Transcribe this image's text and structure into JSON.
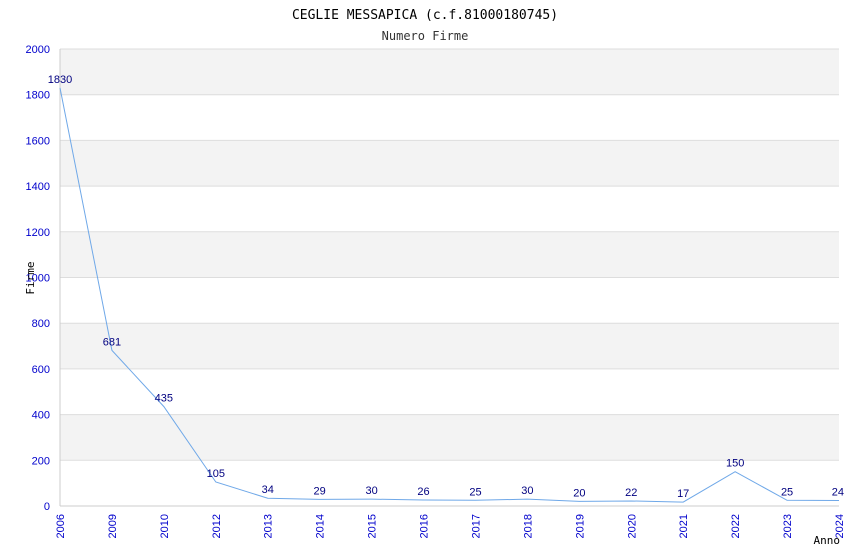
{
  "chart_data": {
    "type": "line",
    "title": "CEGLIE MESSAPICA (c.f.81000180745)",
    "subtitle": "Numero Firme",
    "xlabel": "Anno",
    "ylabel": "Firme",
    "categories": [
      "2006",
      "2009",
      "2010",
      "2012",
      "2013",
      "2014",
      "2015",
      "2016",
      "2017",
      "2018",
      "2019",
      "2020",
      "2021",
      "2022",
      "2023",
      "2024"
    ],
    "values": [
      1830,
      681,
      435,
      105,
      34,
      29,
      30,
      26,
      25,
      30,
      20,
      22,
      17,
      150,
      25,
      24
    ],
    "ylim": [
      0,
      2000
    ],
    "yticks": [
      0,
      200,
      400,
      600,
      800,
      1000,
      1200,
      1400,
      1600,
      1800,
      2000
    ],
    "grid": true,
    "line_color": "#6fa8e8",
    "band_color": "#f3f3f3",
    "tick_color": "#0000cc",
    "label_color": "#000080"
  }
}
